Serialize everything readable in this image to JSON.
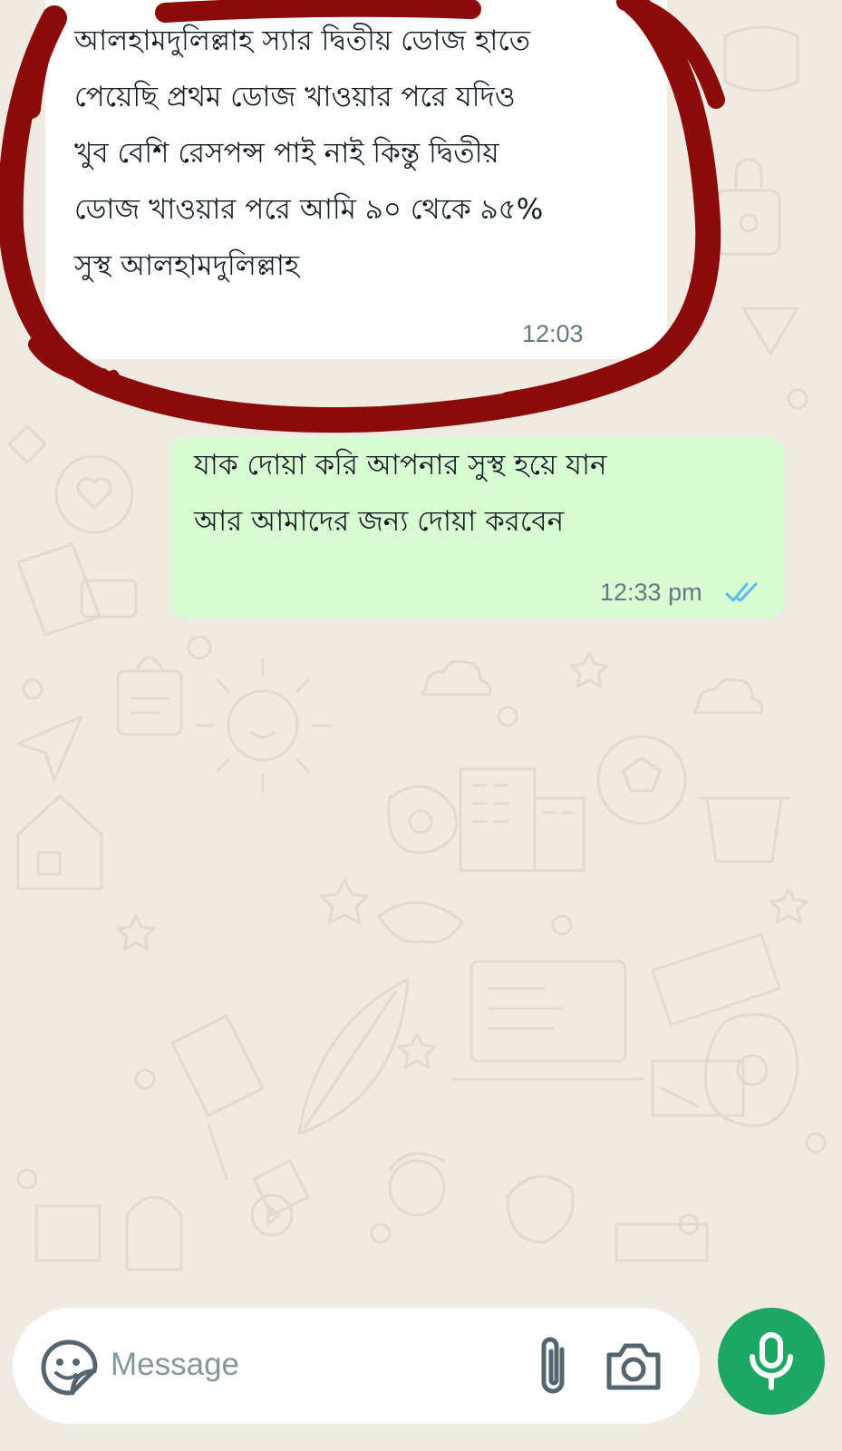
{
  "chat": {
    "messages": [
      {
        "direction": "incoming",
        "text": "আলহামদুলিল্লাহ স্যার দ্বিতীয় ডোজ হাতে\nপেয়েছি প্রথম ডোজ খাওয়ার পরে যদিও\nখুব বেশি রেসপন্স পাই নাই কিন্তু দ্বিতীয়\nডোজ খাওয়ার পরে আমি ৯০ থেকে ৯৫%\nসুস্থ আলহামদুলিল্লাহ",
        "time": "12:03",
        "annotation": "red-circle-marker"
      },
      {
        "direction": "outgoing",
        "text": "যাক দোয়া করি আপনার সুস্থ হয়ে যান\nআর আমাদের জন্য দোয়া করবেন",
        "time": "12:33 pm",
        "status_icon": "double-check-read-icon"
      }
    ]
  },
  "composer": {
    "placeholder": "Message",
    "value": "",
    "icons": [
      "sticker-icon",
      "attach-icon",
      "camera-icon",
      "mic-icon"
    ]
  },
  "colors": {
    "background": "#efeae2",
    "incoming_bubble": "#ffffff",
    "outgoing_bubble": "#d9fdd3",
    "read_tick": "#53bdeb",
    "mic_button": "#1da664",
    "annotation_red": "#8b0a0a"
  }
}
